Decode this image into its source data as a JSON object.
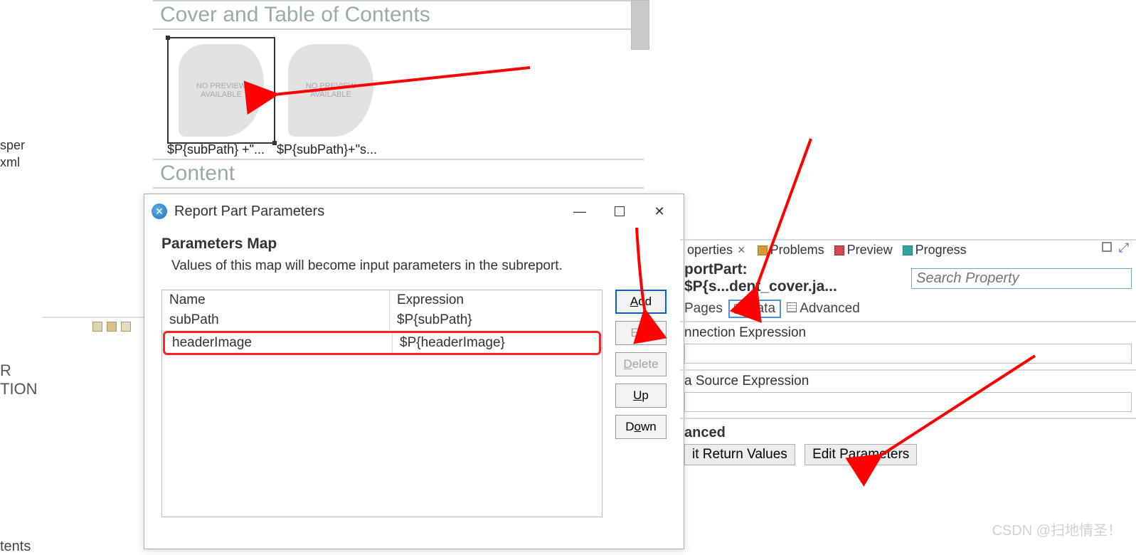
{
  "left": {
    "sn1": "sper",
    "sn2": "xml",
    "r": "R",
    "tion": "TION",
    "tents": "tents"
  },
  "design": {
    "section1": "Cover and Table of Contents",
    "section2": "Content",
    "noPreview1": "NO PREVIEW",
    "noPreview2": "AVAILABLE",
    "cap1": "$P{subPath} +\"...",
    "cap2": "$P{subPath}+\"s..."
  },
  "dialog": {
    "windowTitle": "Report Part Parameters",
    "title": "Parameters Map",
    "desc": "Values of this map will become input parameters in the subreport.",
    "colName": "Name",
    "colExpr": "Expression",
    "rows": [
      {
        "name": "subPath",
        "expr": "$P{subPath}"
      },
      {
        "name": "headerImage",
        "expr": "$P{headerImage}"
      }
    ],
    "buttons": {
      "add": "Add",
      "edit": "Edit",
      "delete": "Delete",
      "up": "Up",
      "down": "Down"
    }
  },
  "right": {
    "tabs": {
      "properties": "operties",
      "problems": "Problems",
      "preview": "Preview",
      "progress": "Progress"
    },
    "selTitle": "portPart: $P{s...dent_cover.ja...",
    "searchPlaceholder": "Search Property",
    "secPages": "Pages",
    "secData": "Data",
    "secAdvanced": "Advanced",
    "connExpr": "nnection Expression",
    "dsExpr": "a Source Expression",
    "advLabel": "anced",
    "editReturn": "it Return Values",
    "editParams": "Edit Parameters"
  },
  "watermark": "CSDN @扫地情圣！"
}
